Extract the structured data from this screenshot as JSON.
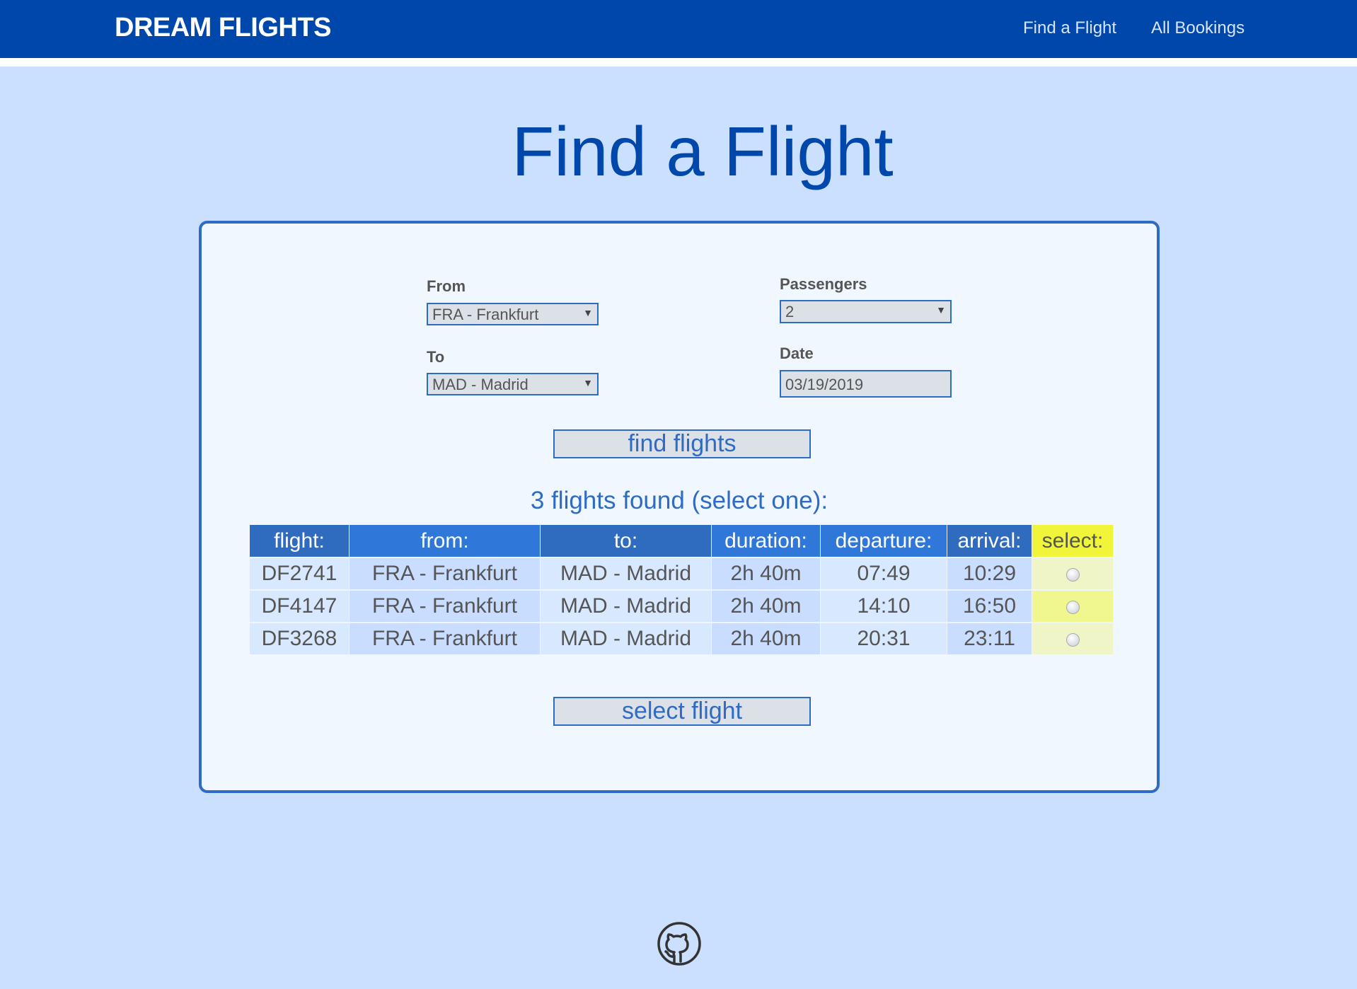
{
  "header": {
    "logo": "DREAM FLIGHTS",
    "nav": [
      "Find a Flight",
      "All Bookings"
    ]
  },
  "page_title": "Find a Flight",
  "form": {
    "from_label": "From",
    "from_value": "FRA - Frankfurt",
    "to_label": "To",
    "to_value": "MAD - Madrid",
    "passengers_label": "Passengers",
    "passengers_value": "2",
    "date_label": "Date",
    "date_value": "03/19/2019",
    "find_button": "find flights"
  },
  "results": {
    "summary": "3 flights found (select one):",
    "columns": [
      "flight:",
      "from:",
      "to:",
      "duration:",
      "departure:",
      "arrival:",
      "select:"
    ],
    "rows": [
      [
        "DF2741",
        "FRA - Frankfurt",
        "MAD - Madrid",
        "2h 40m",
        "07:49",
        "10:29"
      ],
      [
        "DF4147",
        "FRA - Frankfurt",
        "MAD - Madrid",
        "2h 40m",
        "14:10",
        "16:50"
      ],
      [
        "DF3268",
        "FRA - Frankfurt",
        "MAD - Madrid",
        "2h 40m",
        "20:31",
        "23:11"
      ]
    ],
    "select_button": "select flight"
  },
  "footer": {
    "icon": "github-icon"
  }
}
